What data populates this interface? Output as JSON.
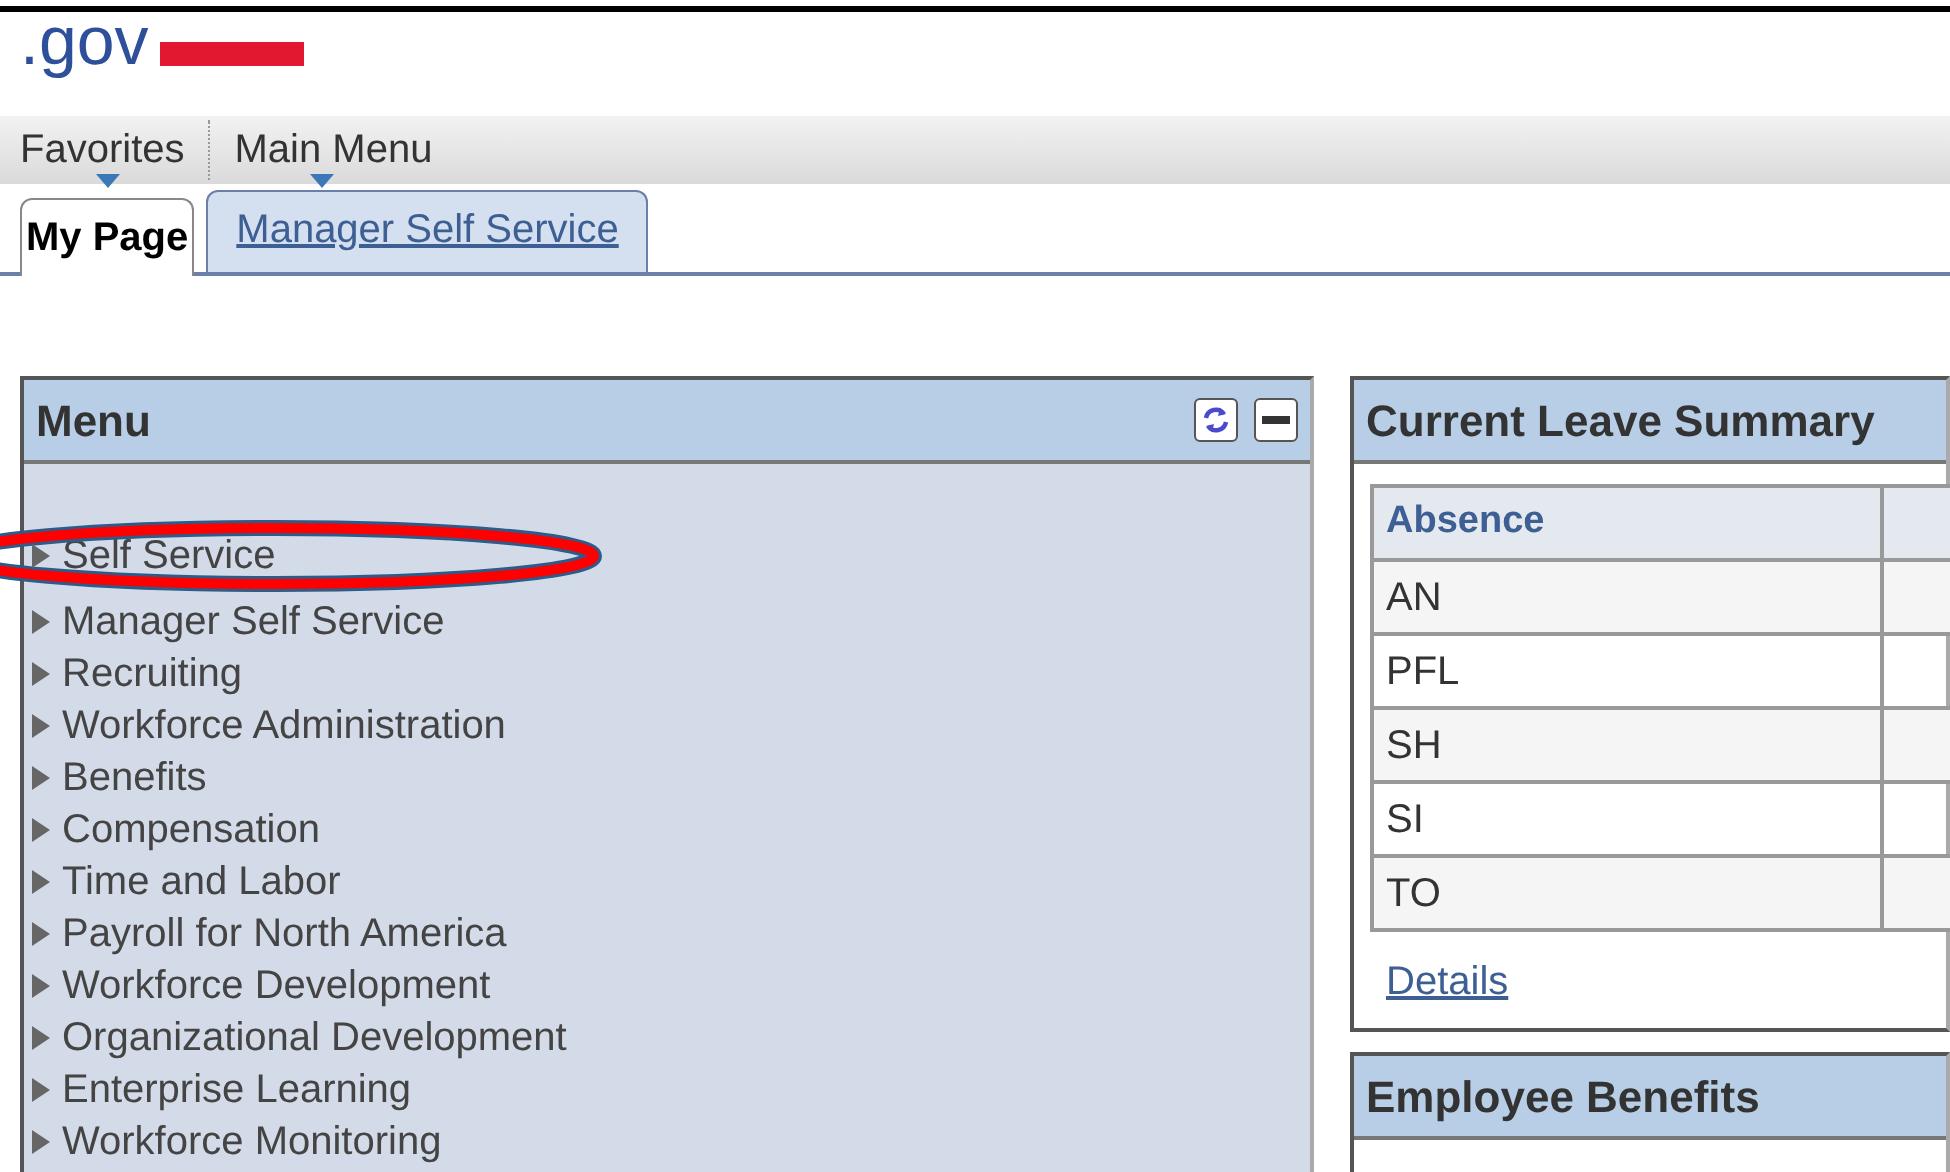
{
  "logo": {
    "text": ".gov"
  },
  "menu_bar": [
    {
      "label": "Favorites"
    },
    {
      "label": "Main Menu"
    }
  ],
  "tabs": [
    {
      "label": "My Page",
      "selected": true
    },
    {
      "label": "Manager Self Service",
      "selected": false
    }
  ],
  "menu_panel": {
    "title": "Menu",
    "items": [
      {
        "label": "Self Service",
        "circled": true
      },
      {
        "label": "Manager Self Service"
      },
      {
        "label": "Recruiting"
      },
      {
        "label": "Workforce Administration"
      },
      {
        "label": "Benefits"
      },
      {
        "label": "Compensation"
      },
      {
        "label": "Time and Labor"
      },
      {
        "label": "Payroll for North America"
      },
      {
        "label": "Workforce Development"
      },
      {
        "label": "Organizational Development"
      },
      {
        "label": "Enterprise Learning"
      },
      {
        "label": "Workforce Monitoring"
      }
    ]
  },
  "leave_summary": {
    "title": "Current Leave Summary",
    "columns": [
      "Absence"
    ],
    "rows": [
      "AN",
      "PFL",
      "SH",
      "SI",
      "TO"
    ],
    "link": "Details"
  },
  "benefits": {
    "title": "Employee Benefits"
  }
}
